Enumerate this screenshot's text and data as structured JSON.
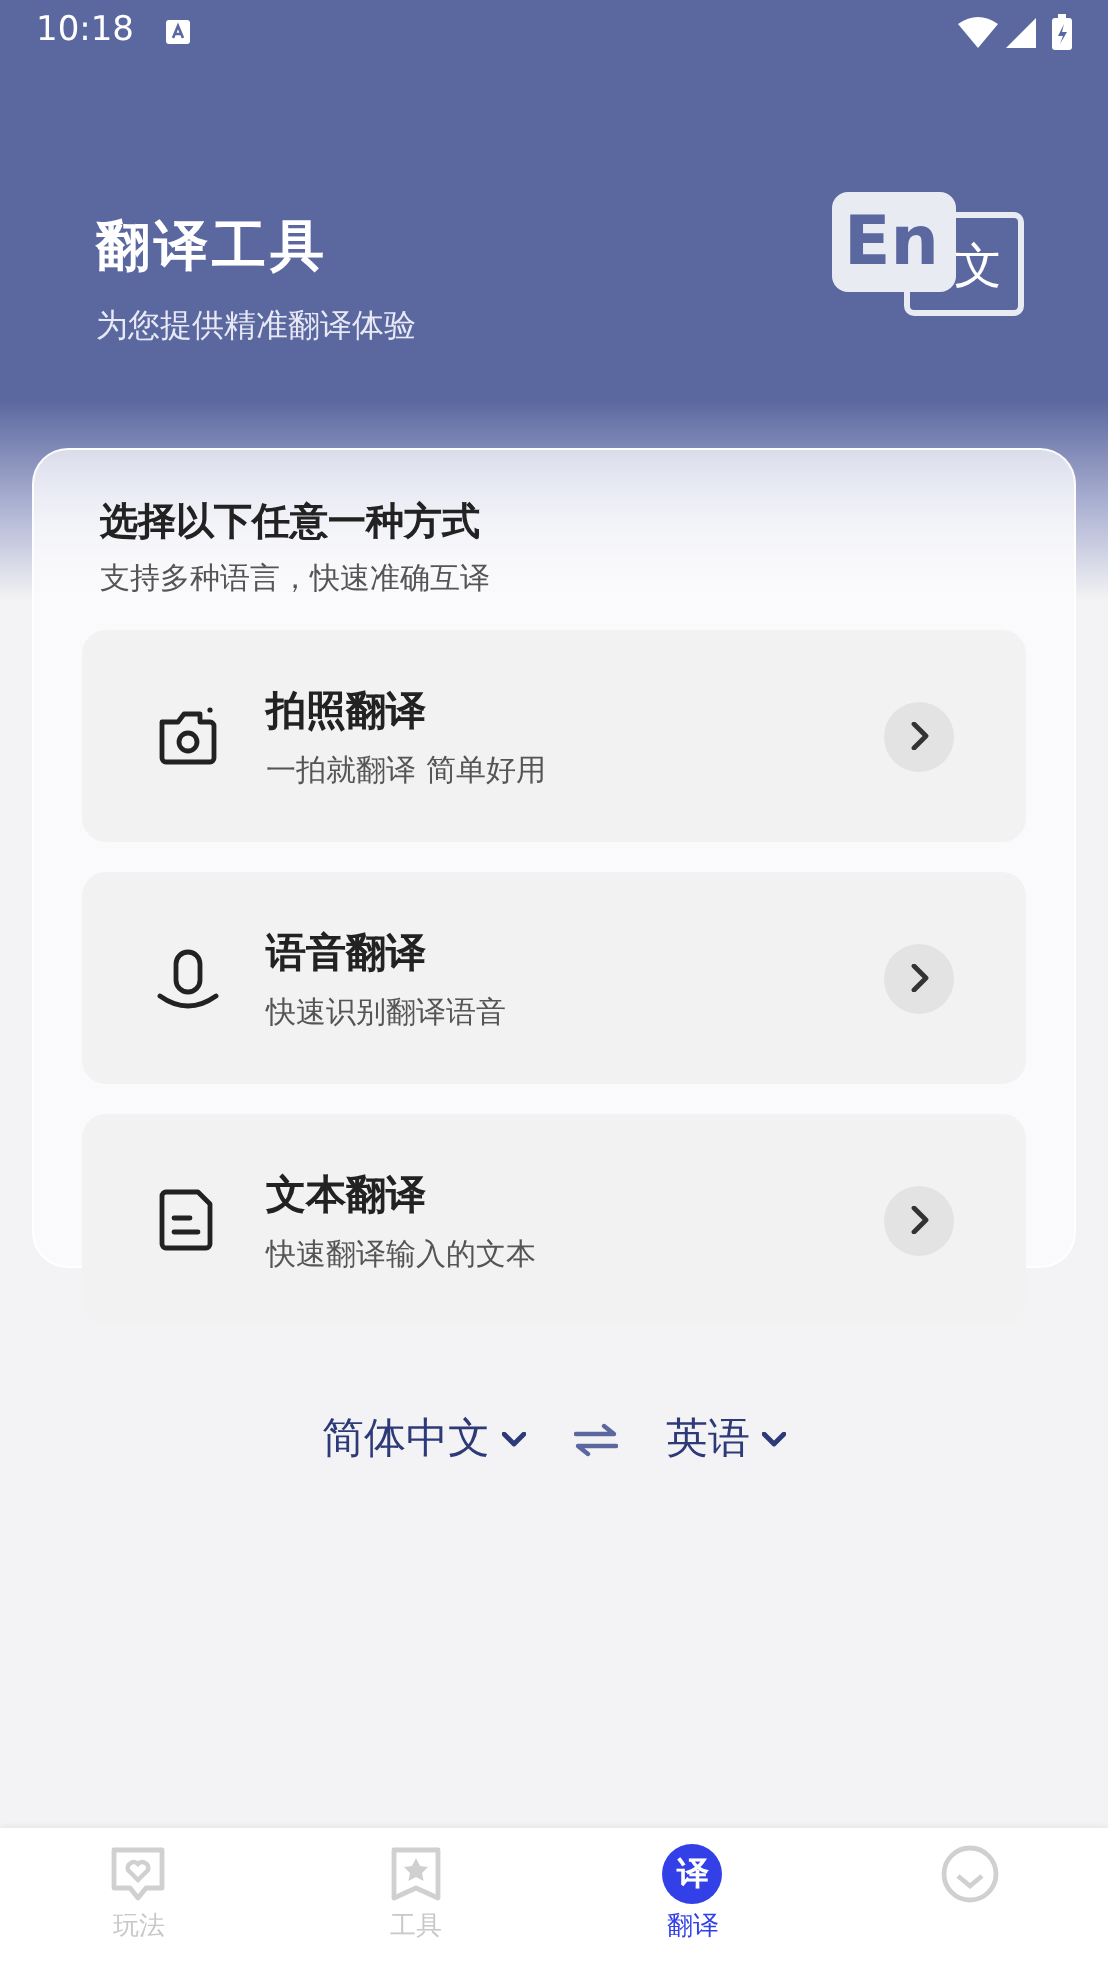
{
  "status_bar": {
    "time": "10:18"
  },
  "header": {
    "title": "翻译工具",
    "subtitle": "为您提供精准翻译体验",
    "logo": {
      "latin": "En",
      "cjk": "文"
    }
  },
  "panel": {
    "title": "选择以下任意一种方式",
    "subtitle": "支持多种语言，快速准确互译",
    "options": [
      {
        "kind": "camera",
        "title": "拍照翻译",
        "subtitle": "一拍就翻译 简单好用"
      },
      {
        "kind": "voice",
        "title": "语音翻译",
        "subtitle": "快速识别翻译语音"
      },
      {
        "kind": "text",
        "title": "文本翻译",
        "subtitle": "快速翻译输入的文本"
      }
    ]
  },
  "languages": {
    "source": "简体中文",
    "target": "英语"
  },
  "tabs": [
    {
      "kind": "heart",
      "label": "玩法",
      "selected": false
    },
    {
      "kind": "star",
      "label": "工具",
      "selected": false
    },
    {
      "kind": "badge",
      "badge": "译",
      "label": "翻译",
      "selected": true
    },
    {
      "kind": "check",
      "selected": false
    }
  ]
}
